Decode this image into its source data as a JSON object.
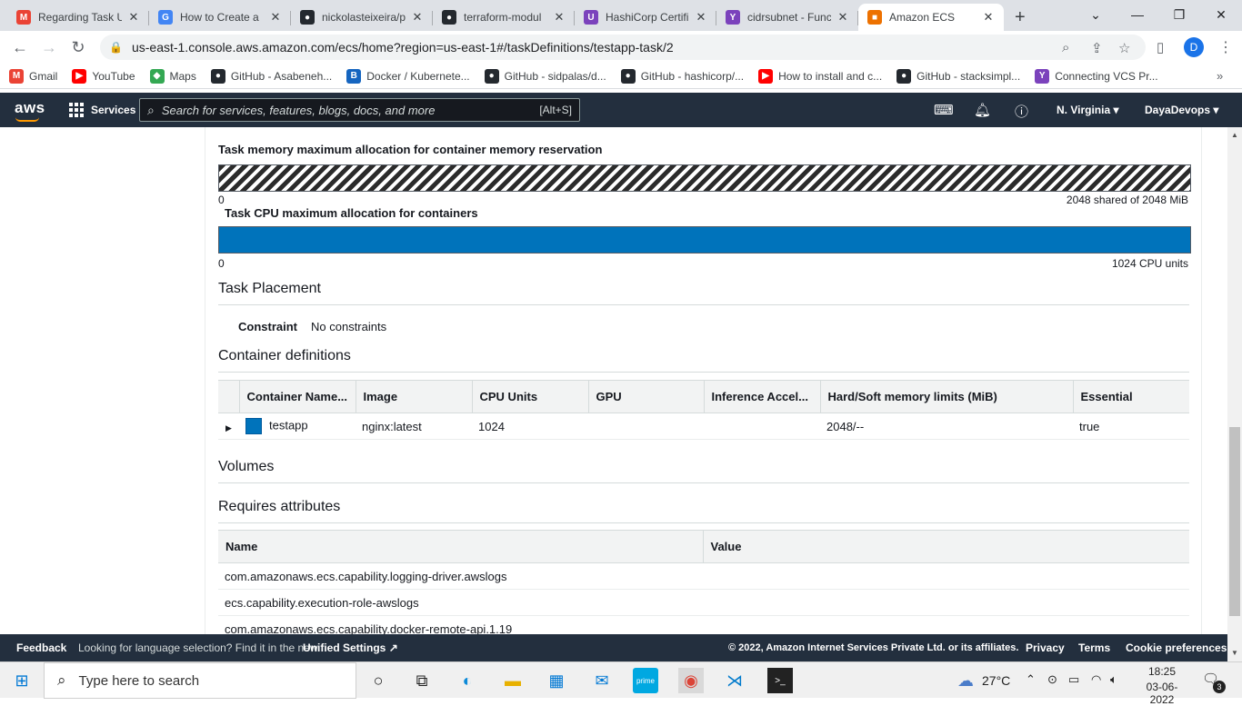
{
  "browser": {
    "tabs": [
      {
        "title": "Regarding Task U",
        "favicon": "gmail-icon",
        "color": "#ea4335",
        "glyph": "M"
      },
      {
        "title": "How to Create a",
        "favicon": "google-icon",
        "color": "#4285f4",
        "glyph": "G"
      },
      {
        "title": "nickolasteixeira/p",
        "favicon": "github-icon",
        "color": "#24292f",
        "glyph": "●"
      },
      {
        "title": "terraform-modul",
        "favicon": "github-icon",
        "color": "#24292f",
        "glyph": "●"
      },
      {
        "title": "HashiCorp Certifi",
        "favicon": "hashicorp-icon",
        "color": "#7b42bc",
        "glyph": "U"
      },
      {
        "title": "cidrsubnet - Func",
        "favicon": "terraform-icon",
        "color": "#7b42bc",
        "glyph": "Y"
      },
      {
        "title": "Amazon ECS",
        "favicon": "ecs-icon",
        "color": "#ed7100",
        "glyph": "■"
      }
    ],
    "new_tab": "+",
    "url": "us-east-1.console.aws.amazon.com/ecs/home?region=us-east-1#/taskDefinitions/testapp-task/2",
    "profile_initial": "D",
    "bookmarks": [
      {
        "label": "Gmail",
        "icon": "gmail-icon",
        "color": "#ea4335",
        "glyph": "M"
      },
      {
        "label": "YouTube",
        "icon": "youtube-icon",
        "color": "#ff0000",
        "glyph": "▶"
      },
      {
        "label": "Maps",
        "icon": "maps-icon",
        "color": "#34a853",
        "glyph": "◆"
      },
      {
        "label": "GitHub - Asabeneh...",
        "icon": "github-icon",
        "color": "#24292f",
        "glyph": "●"
      },
      {
        "label": "Docker / Kubernete...",
        "icon": "b-icon",
        "color": "#1565c0",
        "glyph": "B"
      },
      {
        "label": "GitHub - sidpalas/d...",
        "icon": "github-icon",
        "color": "#24292f",
        "glyph": "●"
      },
      {
        "label": "GitHub - hashicorp/...",
        "icon": "github-icon",
        "color": "#24292f",
        "glyph": "●"
      },
      {
        "label": "How to install and c...",
        "icon": "youtube-icon",
        "color": "#ff0000",
        "glyph": "▶"
      },
      {
        "label": "GitHub - stacksimpl...",
        "icon": "github-icon",
        "color": "#24292f",
        "glyph": "●"
      },
      {
        "label": "Connecting VCS Pr...",
        "icon": "terraform-icon",
        "color": "#7b42bc",
        "glyph": "Y"
      }
    ]
  },
  "aws_nav": {
    "logo": "aws",
    "services": "Services",
    "search_placeholder": "Search for services, features, blogs, docs, and more",
    "search_shortcut": "[Alt+S]",
    "region": "N. Virginia ▾",
    "account": "DayaDevops ▾"
  },
  "task": {
    "memory": {
      "label": "Task memory maximum allocation for container memory reservation",
      "min": "0",
      "max": "2048 shared of 2048 MiB",
      "fraction": 1.0
    },
    "cpu": {
      "label": "Task CPU maximum allocation for containers",
      "min": "0",
      "max": "1024 CPU units",
      "fraction": 1.0
    },
    "placement": {
      "heading": "Task Placement",
      "constraint_label": "Constraint",
      "constraint_value": "No constraints"
    },
    "containers": {
      "heading": "Container definitions",
      "columns": [
        "Container Name...",
        "Image",
        "CPU Units",
        "GPU",
        "Inference Accel...",
        "Hard/Soft memory limits (MiB)",
        "Essential"
      ],
      "rows": [
        {
          "name": "testapp",
          "image": "nginx:latest",
          "cpu": "1024",
          "gpu": "",
          "inference": "",
          "memory": "2048/--",
          "essential": "true"
        }
      ]
    },
    "volumes": {
      "heading": "Volumes"
    },
    "attributes": {
      "heading": "Requires attributes",
      "columns": [
        "Name",
        "Value"
      ],
      "rows": [
        {
          "name": "com.amazonaws.ecs.capability.logging-driver.awslogs",
          "value": ""
        },
        {
          "name": "ecs.capability.execution-role-awslogs",
          "value": ""
        },
        {
          "name": "com.amazonaws.ecs.capability.docker-remote-api.1.19",
          "value": ""
        }
      ]
    }
  },
  "footer": {
    "feedback": "Feedback",
    "lang_prompt": "Looking for language selection? Find it in the new",
    "unified_settings": "Unified Settings",
    "copyright": "© 2022, Amazon Internet Services Private Ltd. or its affiliates.",
    "privacy": "Privacy",
    "terms": "Terms",
    "cookies": "Cookie preferences"
  },
  "taskbar": {
    "search_placeholder": "Type here to search",
    "temperature": "27°C",
    "time": "18:25",
    "date": "03-06-2022",
    "notifications": "3"
  }
}
